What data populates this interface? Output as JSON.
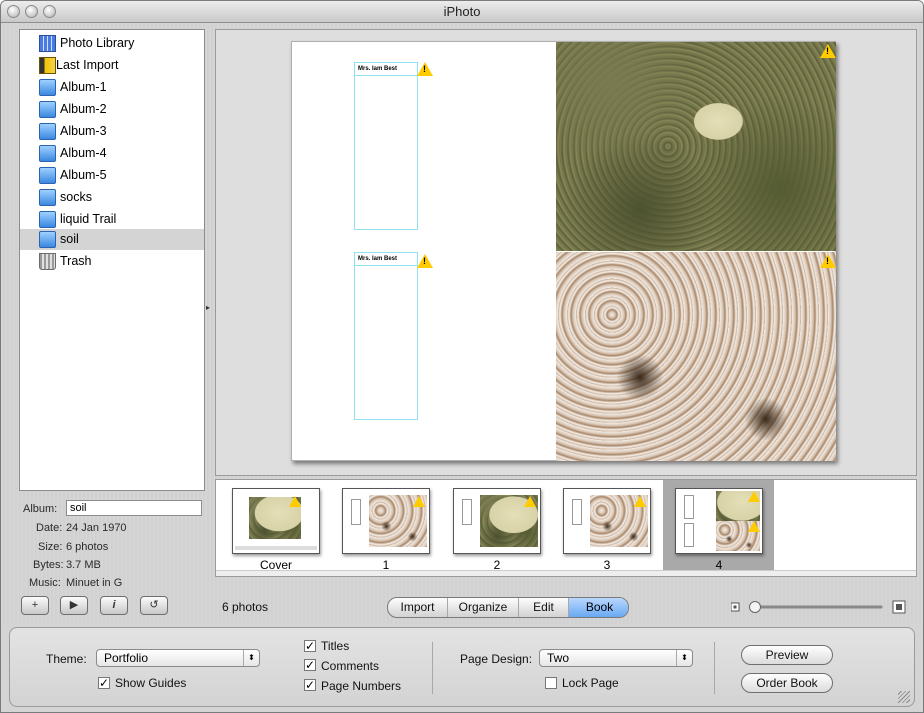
{
  "window": {
    "title": "iPhoto"
  },
  "sources": [
    {
      "label": "Photo Library",
      "icon": "photo-library-icon"
    },
    {
      "label": "Last Import",
      "icon": "film-roll-icon"
    },
    {
      "label": "Album-1",
      "icon": "album-folder-icon"
    },
    {
      "label": "Album-2",
      "icon": "album-folder-icon"
    },
    {
      "label": "Album-3",
      "icon": "album-folder-icon"
    },
    {
      "label": "Album-4",
      "icon": "album-folder-icon"
    },
    {
      "label": "Album-5",
      "icon": "album-folder-icon"
    },
    {
      "label": "socks",
      "icon": "album-folder-icon"
    },
    {
      "label": "liquid Trail",
      "icon": "album-folder-icon"
    },
    {
      "label": "soil",
      "icon": "album-folder-icon",
      "selected": true
    },
    {
      "label": "Trash",
      "icon": "trash-icon"
    }
  ],
  "info": {
    "album_label": "Album:",
    "album_value": "soil",
    "date_label": "Date:",
    "date_value": "24 Jan 1970",
    "size_label": "Size:",
    "size_value": "6 photos",
    "bytes_label": "Bytes:",
    "bytes_value": "3.7 MB",
    "music_label": "Music:",
    "music_value": "Minuet in G"
  },
  "page_preview": {
    "textbox_title": "Mrs. Iam Best",
    "warning_glyph": "!"
  },
  "thumbnails": [
    {
      "label": "Cover"
    },
    {
      "label": "1"
    },
    {
      "label": "2"
    },
    {
      "label": "3"
    },
    {
      "label": "4",
      "selected": true
    }
  ],
  "toolbar": {
    "add_icon": "+",
    "play_icon": "▶",
    "info_icon": "i",
    "rotate_icon": "↺",
    "photo_count": "6 photos",
    "modes": [
      "Import",
      "Organize",
      "Edit",
      "Book"
    ],
    "active_mode": "Book"
  },
  "book": {
    "theme_label": "Theme:",
    "theme_value": "Portfolio",
    "show_guides_label": "Show Guides",
    "show_guides": true,
    "titles_label": "Titles",
    "titles": true,
    "comments_label": "Comments",
    "comments": true,
    "page_numbers_label": "Page Numbers",
    "page_numbers": true,
    "page_design_label": "Page Design:",
    "page_design_value": "Two",
    "lock_page_label": "Lock Page",
    "lock_page": false,
    "preview_label": "Preview",
    "order_book_label": "Order Book",
    "check_glyph": "✓",
    "popup_arrow": "⬍"
  },
  "colors": {
    "selection": "#d4d4d4",
    "active_mode": "#6aa8f2",
    "guide": "#8fe3f0",
    "warning": "#ffcc00"
  }
}
